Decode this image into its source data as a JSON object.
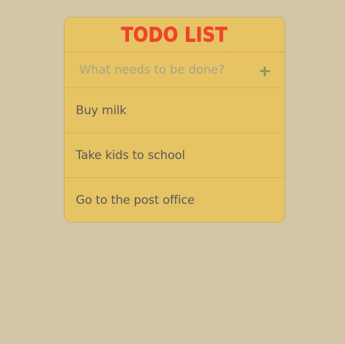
{
  "header": {
    "title": "TODO LIST"
  },
  "new_todo": {
    "placeholder": "What needs to be done?",
    "value": "",
    "add_icon": "plus-icon"
  },
  "todos": [
    {
      "label": "Buy milk"
    },
    {
      "label": "Take kids to school"
    },
    {
      "label": "Go to the post office"
    }
  ],
  "colors": {
    "page_background": "#d3c5a5",
    "card_background": "#e6c464",
    "title": "#f0442a",
    "add_icon": "#8d985e",
    "item_text": "#585858"
  }
}
